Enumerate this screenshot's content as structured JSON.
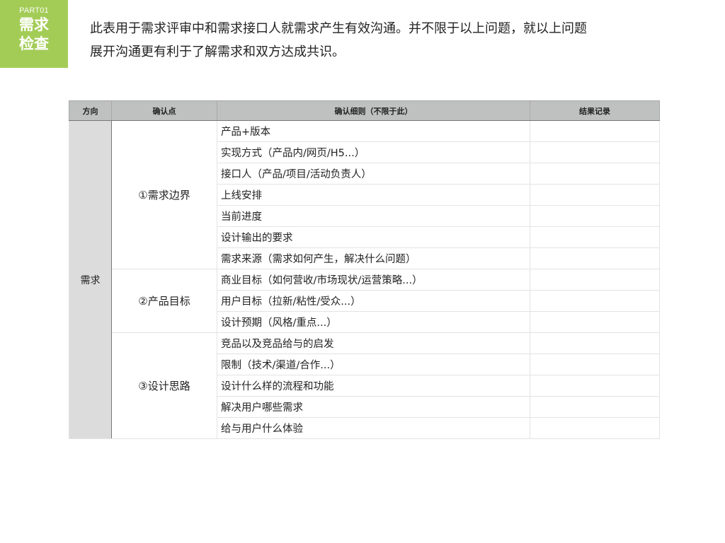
{
  "badge": {
    "part": "PART01",
    "line1": "需求",
    "line2": "检查",
    "color": "#a3cc57"
  },
  "intro": {
    "line1": "此表用于需求评审中和需求接口人就需求产生有效沟通。并不限于以上问题，就以上问题",
    "line2": "展开沟通更有利于了解需求和双方达成共识。"
  },
  "table": {
    "headers": [
      "方向",
      "确认点",
      "确认细则（不限于此）",
      "结果记录"
    ],
    "direction": "需求",
    "groups": [
      {
        "point": "①需求边界",
        "details": [
          "产品+版本",
          "实现方式（产品内/网页/H5...）",
          "接口人（产品/项目/活动负责人）",
          "上线安排",
          "当前进度",
          "设计输出的要求",
          "需求来源（需求如何产生，解决什么问题）"
        ]
      },
      {
        "point": "②产品目标",
        "details": [
          "商业目标（如何营收/市场现状/运营策略...）",
          "用户目标（拉新/粘性/受众...）",
          "设计预期（风格/重点...）"
        ]
      },
      {
        "point": "③设计思路",
        "details": [
          "竞品以及竞品给与的启发",
          "限制（技术/渠道/合作...）",
          "设计什么样的流程和功能",
          "解决用户哪些需求",
          "给与用户什么体验"
        ]
      }
    ]
  }
}
